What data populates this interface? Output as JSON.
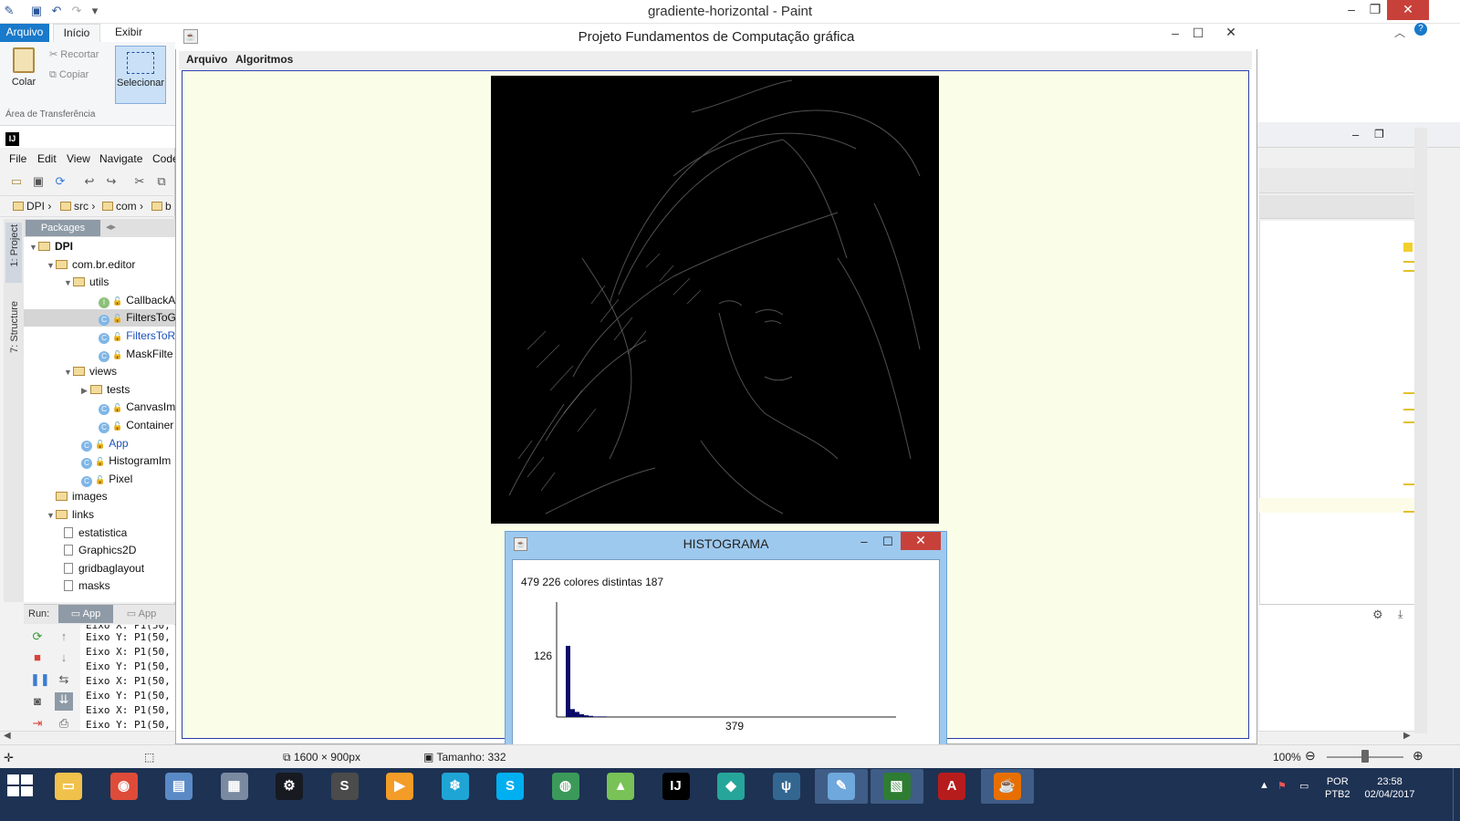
{
  "paint": {
    "title": "gradiente-horizontal - Paint",
    "tabs": [
      "Arquivo",
      "Início",
      "Exibir"
    ],
    "clipboard": {
      "paste": "Colar",
      "cut": "Recortar",
      "copy": "Copiar",
      "group_label": "Área de Transferência"
    },
    "select": "Selecionar",
    "status": {
      "dimensions": "1600 × 900px",
      "size": "Tamanho: 332",
      "zoom": "100%"
    }
  },
  "ide": {
    "logo": "IJ",
    "menu": [
      "File",
      "Edit",
      "View",
      "Navigate",
      "Code"
    ],
    "breadcrumb": [
      "DPI",
      "src",
      "com",
      "b"
    ],
    "side_tabs": {
      "project": "1: Project",
      "structure": "7: Structure"
    },
    "packages_tab": "Packages",
    "tree": [
      {
        "label": "DPI",
        "kind": "folder",
        "depth": 0,
        "open": true,
        "bold": true
      },
      {
        "label": "com.br.editor",
        "kind": "folder",
        "depth": 1,
        "open": true
      },
      {
        "label": "utils",
        "kind": "folder",
        "depth": 2,
        "open": true
      },
      {
        "label": "CallbackA",
        "kind": "interface",
        "depth": 4
      },
      {
        "label": "FiltersToG",
        "kind": "class",
        "depth": 4,
        "selected": true
      },
      {
        "label": "FiltersToR",
        "kind": "class",
        "depth": 4,
        "blue": true
      },
      {
        "label": "MaskFilte",
        "kind": "class",
        "depth": 4
      },
      {
        "label": "views",
        "kind": "folder",
        "depth": 2,
        "open": true
      },
      {
        "label": "tests",
        "kind": "folder",
        "depth": 3,
        "open": false
      },
      {
        "label": "CanvasIm",
        "kind": "class",
        "depth": 4
      },
      {
        "label": "Container",
        "kind": "class",
        "depth": 4
      },
      {
        "label": "App",
        "kind": "class",
        "depth": 3,
        "blue": true
      },
      {
        "label": "HistogramIm",
        "kind": "class",
        "depth": 3
      },
      {
        "label": "Pixel",
        "kind": "class",
        "depth": 3
      },
      {
        "label": "images",
        "kind": "folder",
        "depth": 1
      },
      {
        "label": "links",
        "kind": "folder",
        "depth": 1,
        "open": true
      },
      {
        "label": "estatistica",
        "kind": "file",
        "depth": 2
      },
      {
        "label": "Graphics2D",
        "kind": "file",
        "depth": 2
      },
      {
        "label": "gridbaglayout",
        "kind": "file",
        "depth": 2
      },
      {
        "label": "masks",
        "kind": "file",
        "depth": 2
      }
    ],
    "run": {
      "label": "Run:",
      "tabs": [
        "App",
        "App"
      ],
      "console": [
        "Eixo Y: P1(50,",
        "Eixo X: P1(50,",
        "Eixo Y: P1(50,",
        "Eixo X: P1(50,",
        "Eixo Y: P1(50,",
        "Eixo X: P1(50,"
      ]
    }
  },
  "app": {
    "title": "Projeto Fundamentos de Computação gráfica",
    "menu": [
      "Arquivo",
      "Algoritmos"
    ]
  },
  "histogram": {
    "title": "HISTOGRAMA",
    "stats": "479 226 colores distintas 187",
    "y_label": "126",
    "x_label": "379"
  },
  "chart_data": {
    "type": "bar",
    "title": "",
    "xlabel": "379",
    "ylabel": "126",
    "values": [
      126,
      14,
      9,
      5,
      3,
      2,
      1,
      1,
      1
    ]
  },
  "taskbar": {
    "apps": [
      "file-explorer",
      "chrome",
      "task-manager",
      "calculator",
      "steam",
      "sublime-text",
      "media-player",
      "app",
      "skype",
      "globe",
      "android-studio",
      "intellij",
      "git-kraken",
      "postgresql",
      "paint",
      "clapperboard",
      "acrobat",
      "java"
    ],
    "language": {
      "line1": "POR",
      "line2": "PTB2"
    },
    "clock": {
      "time": "23:58",
      "date": "02/04/2017"
    }
  },
  "colors": {
    "accent": "#1979ca",
    "java_bg": "#fafde8",
    "histogram_bar": "#0a0a6a",
    "taskbar": "#1e3253"
  }
}
